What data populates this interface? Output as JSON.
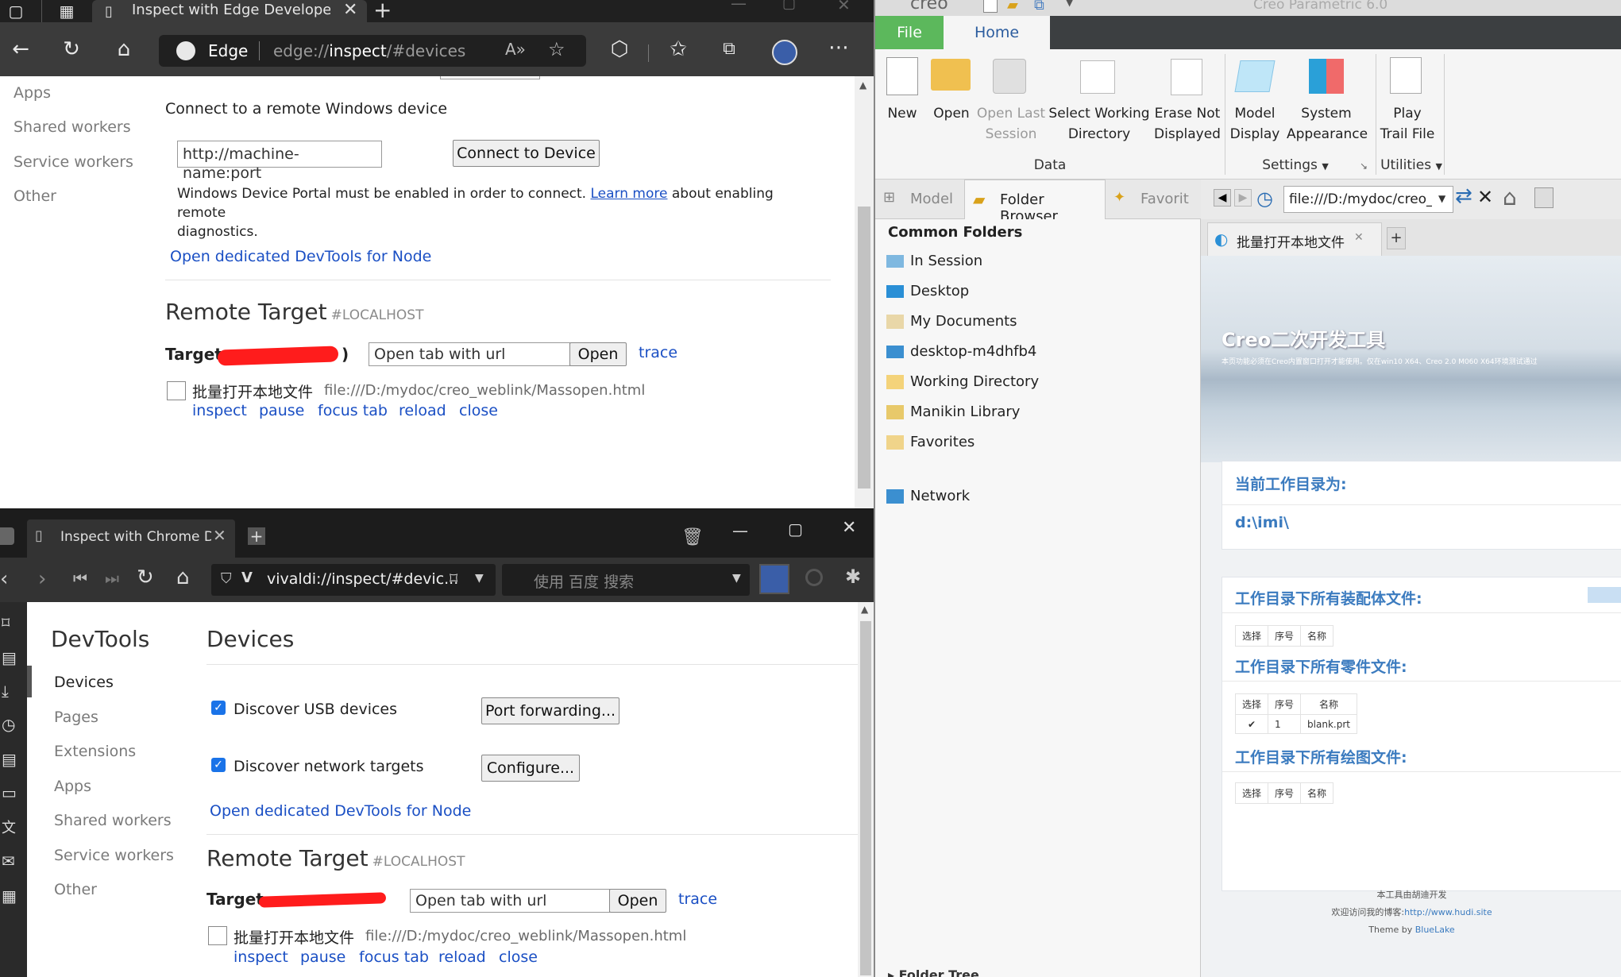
{
  "edge": {
    "tab_title": "Inspect with Edge Developer Too",
    "address_brand": "Edge",
    "address_url_prefix": "edge://",
    "address_url_bold": "inspect",
    "address_url_suffix": "/#devices",
    "sidebar": [
      "Apps",
      "Shared workers",
      "Service workers",
      "Other"
    ],
    "connect_heading": "Connect to a remote Windows device",
    "connect_placeholder": "http://machine-name:port",
    "connect_button": "Connect to Device",
    "portal_note_1": "Windows Device Portal must be enabled in order to connect.",
    "portal_note_link": "Learn more",
    "portal_note_2": "about enabling remote",
    "portal_note_3": "diagnostics.",
    "open_node_link": "Open dedicated DevTools for Node",
    "remote_title": "Remote Target",
    "remote_host": "#LOCALHOST",
    "target_label": "Target",
    "target_close_paren": ")",
    "open_tab_placeholder": "Open tab with url",
    "open_button": "Open",
    "trace_link": "trace",
    "page_title": "批量打开本地文件",
    "page_url": "file:///D:/mydoc/creo_weblink/Massopen.html",
    "actions": [
      "inspect",
      "pause",
      "focus tab",
      "reload",
      "close"
    ]
  },
  "vivaldi": {
    "tab_title": "Inspect with Chrome D",
    "address": "vivaldi://inspect/#devic...",
    "search_placeholder": "使用 百度 搜索",
    "devtools_title": "DevTools",
    "sidebar": [
      "Devices",
      "Pages",
      "Extensions",
      "Apps",
      "Shared workers",
      "Service workers",
      "Other"
    ],
    "devices_title": "Devices",
    "discover_usb": "Discover USB devices",
    "port_forwarding_button": "Port forwarding...",
    "discover_network": "Discover network targets",
    "configure_button": "Configure...",
    "open_node_link": "Open dedicated DevTools for Node",
    "remote_title": "Remote Target",
    "remote_host": "#LOCALHOST",
    "target_label": "Target",
    "open_tab_placeholder": "Open tab with url",
    "open_button": "Open",
    "trace_link": "trace",
    "page_title": "批量打开本地文件",
    "page_url": "file:///D:/mydoc/creo_weblink/Massopen.html",
    "actions": [
      "inspect",
      "pause",
      "focus tab",
      "reload",
      "close"
    ]
  },
  "creo": {
    "logo": "creo",
    "window_title": "Creo Parametric 6.0",
    "tabs": {
      "file": "File",
      "home": "Home"
    },
    "ribbon": {
      "new": "New",
      "open": "Open",
      "open_last_1": "Open Last",
      "open_last_2": "Session",
      "select_wd_1": "Select Working",
      "select_wd_2": "Directory",
      "erase_1": "Erase Not",
      "erase_2": "Displayed",
      "model_display_1": "Model",
      "model_display_2": "Display",
      "system_app_1": "System",
      "system_app_2": "Appearance",
      "play_trail_1": "Play",
      "play_trail_2": "Trail File",
      "group_data": "Data",
      "group_settings": "Settings",
      "group_utilities": "Utilities"
    },
    "navtabs": {
      "model": "Model",
      "folder_browser": "Folder Browser",
      "favorites": "Favorit"
    },
    "common_folders": "Common Folders",
    "folders": [
      "In Session",
      "Desktop",
      "My Documents",
      "desktop-m4dhfb4",
      "Working Directory",
      "Manikin Library",
      "Favorites"
    ],
    "network": "Network",
    "folder_tree": "Folder Tree",
    "browser_url": "file:///D:/mydoc/creo_weblink/",
    "web_tab_title": "批量打开本地文件",
    "web": {
      "banner_title": "Creo二次开发工具",
      "banner_sub": "本页功能必须在Creo内置窗口打开才能使用。仅在win10 X64、Creo 2.0 M060 X64环境测试通过",
      "wd_label": "当前工作目录为:",
      "wd_value": "d:\\imi\\",
      "asm_label": "工作目录下所有装配体文件:",
      "part_label": "工作目录下所有零件文件:",
      "drw_label": "工作目录下所有绘图文件:",
      "col_select": "选择",
      "col_no": "序号",
      "col_name": "名称",
      "part_row_check": "✔",
      "part_row_no": "1",
      "part_row_name": "blank.prt",
      "footer_1": "本工具由胡迪开发",
      "footer_2": "欢迎访问我的博客:",
      "footer_link": "http://www.hudi.site",
      "footer_3_prefix": "Theme by",
      "footer_3_link": "BlueLake"
    }
  }
}
